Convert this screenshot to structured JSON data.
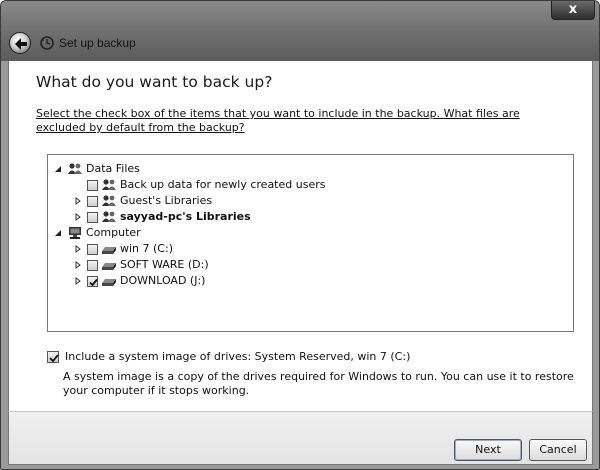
{
  "window": {
    "title": "Set up backup",
    "close_label": "x"
  },
  "main": {
    "heading": "What do you want to back up?",
    "instructions_text": "Select the check box of the items that you want to include in the backup. ",
    "excluded_link": "What files are excluded by default from the backup?"
  },
  "tree": {
    "data_files": {
      "label": "Data Files",
      "children": [
        {
          "label": "Back up data for newly created users",
          "checked": false
        },
        {
          "label": "Guest's Libraries",
          "checked": false
        },
        {
          "label": "sayyad-pc's Libraries",
          "checked": false
        }
      ]
    },
    "computer": {
      "label": "Computer",
      "children": [
        {
          "label": "win 7 (C:)",
          "checked": false
        },
        {
          "label": "SOFT WARE (D:)",
          "checked": false
        },
        {
          "label": "DOWNLOAD (J:)",
          "checked": true
        }
      ]
    }
  },
  "system_image": {
    "checked": true,
    "label": "Include a system image of drives: System Reserved, win 7 (C:)",
    "description": "A system image is a copy of the drives required for Windows to run. You can use it to restore your computer if it stops working."
  },
  "footer": {
    "next_label": "Next",
    "cancel_label": "Cancel"
  },
  "icons": {
    "back": "back-arrow-icon",
    "title": "backup-icon",
    "users": "users-icon",
    "computer": "computer-icon",
    "drive": "drive-icon"
  }
}
